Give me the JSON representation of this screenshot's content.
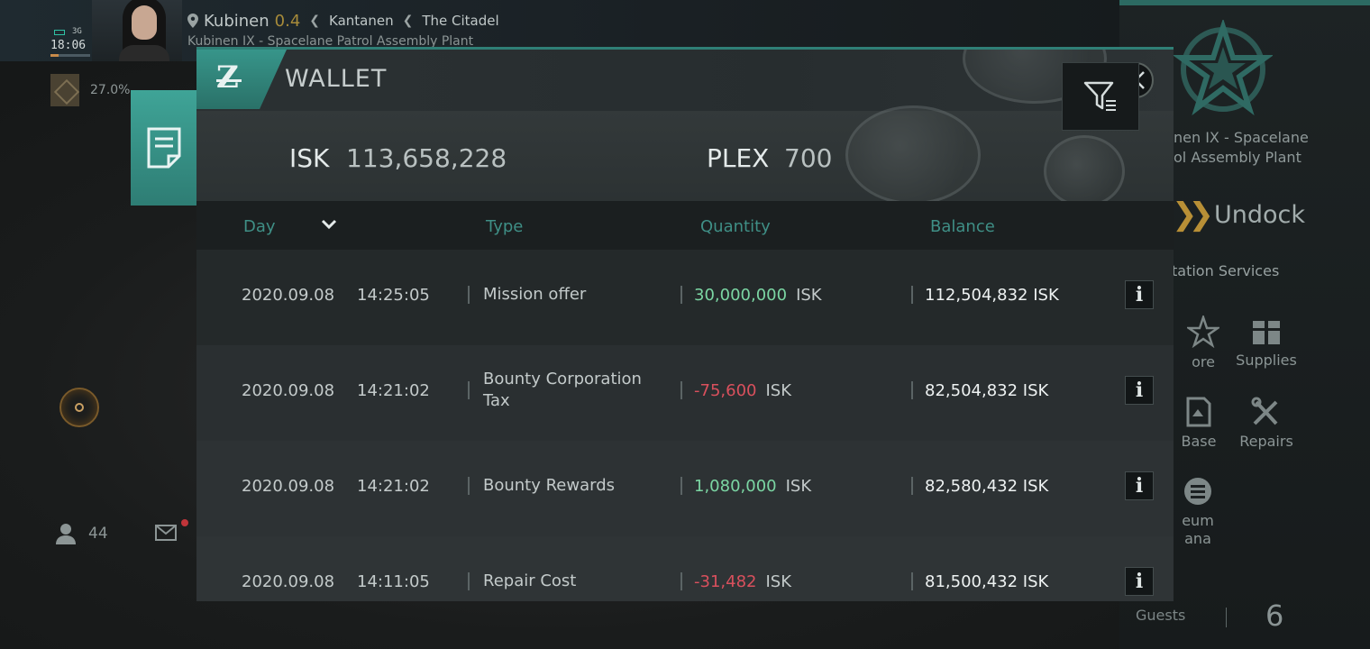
{
  "status": {
    "network": "3G",
    "time": "18:06"
  },
  "location": {
    "system": "Kubinen",
    "security": "0.4",
    "region": "Kantanen",
    "constellation": "The Citadel",
    "station": "Kubinen IX - Spacelane Patrol Assembly Plant"
  },
  "cargo": {
    "percent": "27.0%"
  },
  "social": {
    "online_count": "44"
  },
  "station_panel": {
    "name_line1": "nen IX - Spacelane",
    "name_line2": "ol Assembly Plant",
    "undock_label": "Undock",
    "services_label": "tation Services",
    "services": [
      {
        "label": "ore",
        "icon": "store-icon"
      },
      {
        "label": "Supplies",
        "icon": "supplies-icon"
      },
      {
        "label": "Base",
        "icon": "base-icon"
      },
      {
        "label": "Repairs",
        "icon": "repairs-icon"
      },
      {
        "label": "eum",
        "icon": "museum-icon"
      },
      {
        "label": "ana",
        "icon": ""
      }
    ],
    "guests_label": "Guests",
    "guests_count": "6"
  },
  "wallet": {
    "title": "WALLET",
    "logo_letter": "Z",
    "isk_label": "ISK",
    "isk_value": "113,658,228",
    "plex_label": "PLEX",
    "plex_value": "700",
    "columns": {
      "day": "Day",
      "type": "Type",
      "quantity": "Quantity",
      "balance": "Balance"
    },
    "currency": "ISK",
    "rows": [
      {
        "date": "2020.09.08",
        "time": "14:25:05",
        "type": "Mission offer",
        "quantity": "30,000,000",
        "sign": "positive",
        "balance": "112,504,832 ISK"
      },
      {
        "date": "2020.09.08",
        "time": "14:21:02",
        "type": "Bounty Corporation Tax",
        "quantity": "-75,600",
        "sign": "negative",
        "balance": "82,504,832 ISK"
      },
      {
        "date": "2020.09.08",
        "time": "14:21:02",
        "type": "Bounty Rewards",
        "quantity": "1,080,000",
        "sign": "positive",
        "balance": "82,580,432 ISK"
      },
      {
        "date": "2020.09.08",
        "time": "14:11:05",
        "type": "Repair Cost",
        "quantity": "-31,482",
        "sign": "negative",
        "balance": "81,500,432 ISK"
      }
    ]
  },
  "colors": {
    "accent": "#2f7f76",
    "positive": "#7bd6a3",
    "negative": "#d9505d",
    "column_header": "#3f8f86"
  }
}
